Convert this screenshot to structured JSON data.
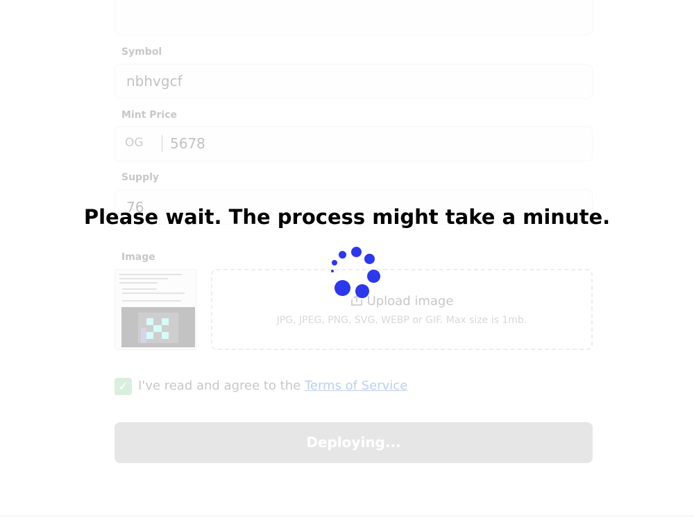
{
  "form": {
    "symbol": {
      "label": "Symbol",
      "value": "nbhvgcf"
    },
    "mint_price": {
      "label": "Mint Price",
      "currency": "OG",
      "value": "5678"
    },
    "supply": {
      "label": "Supply",
      "value": "76"
    },
    "image": {
      "label": "Image",
      "upload_title": "Upload image",
      "upload_hint": "JPG, JPEG, PNG, SVG, WEBP or GIF. Max size is 1mb."
    },
    "agreement": {
      "text": "I've read and agree to the ",
      "link": "Terms of Service",
      "checked": true
    },
    "submit_label": "Deploying..."
  },
  "overlay": {
    "message": "Please wait. The process might take a minute."
  },
  "icons": {
    "upload": "upload-icon",
    "check": "checkmark-icon",
    "spinner": "loading-spinner-icon"
  },
  "colors": {
    "spinner": "#2b38ec",
    "link": "#2e6fe0",
    "checkbox": "#8ccf9c",
    "button_disabled": "#b4b4b4"
  }
}
